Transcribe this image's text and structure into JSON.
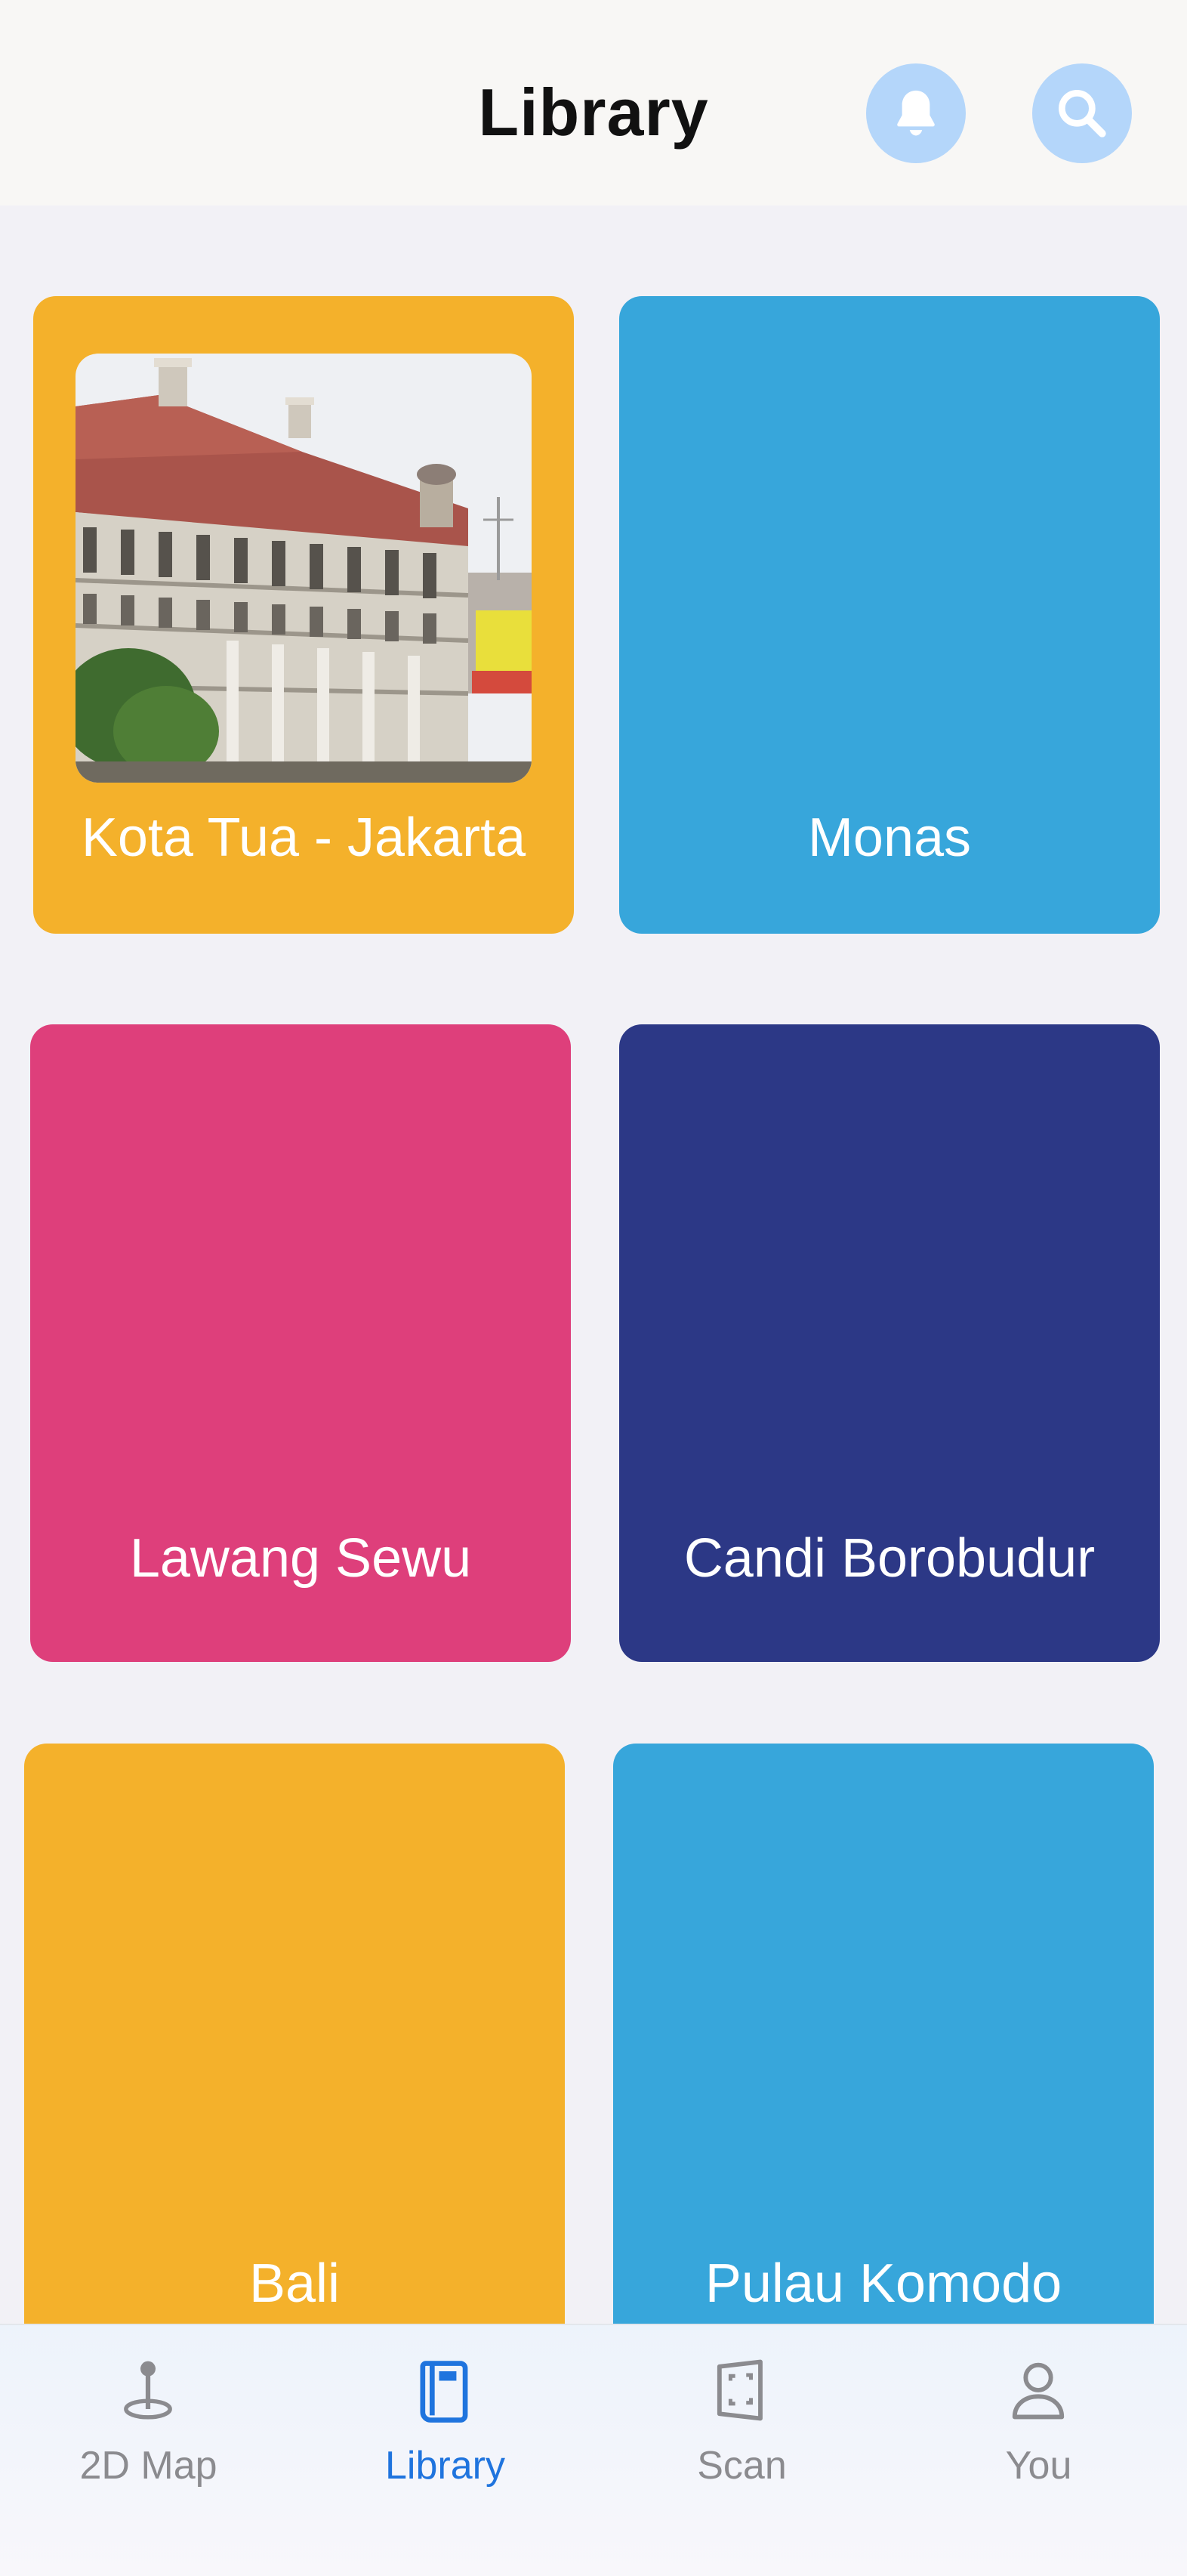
{
  "header": {
    "title": "Library",
    "bell_icon": "bell-icon",
    "search_icon": "search-icon"
  },
  "cards": [
    {
      "label": "Kota Tua - Jakarta",
      "color": "#f4b12b",
      "has_photo": true
    },
    {
      "label": "Monas",
      "color": "#37a6db"
    },
    {
      "label": "Lawang Sewu",
      "color": "#de3f7b"
    },
    {
      "label": "Candi Borobudur",
      "color": "#2c3886"
    },
    {
      "label": "Bali",
      "color": "#f4b12b"
    },
    {
      "label": "Pulau Komodo",
      "color": "#37a6db"
    }
  ],
  "tabbar": {
    "tabs": [
      {
        "label": "2D Map",
        "icon": "map-pin-icon",
        "active": false
      },
      {
        "label": "Library",
        "icon": "book-icon",
        "active": true
      },
      {
        "label": "Scan",
        "icon": "scan-icon",
        "active": false
      },
      {
        "label": "You",
        "icon": "person-icon",
        "active": false
      }
    ]
  },
  "colors": {
    "accent": "#1f74de",
    "header_button_bg": "#b4d6fa",
    "inactive_tab": "#8b8b8f"
  }
}
